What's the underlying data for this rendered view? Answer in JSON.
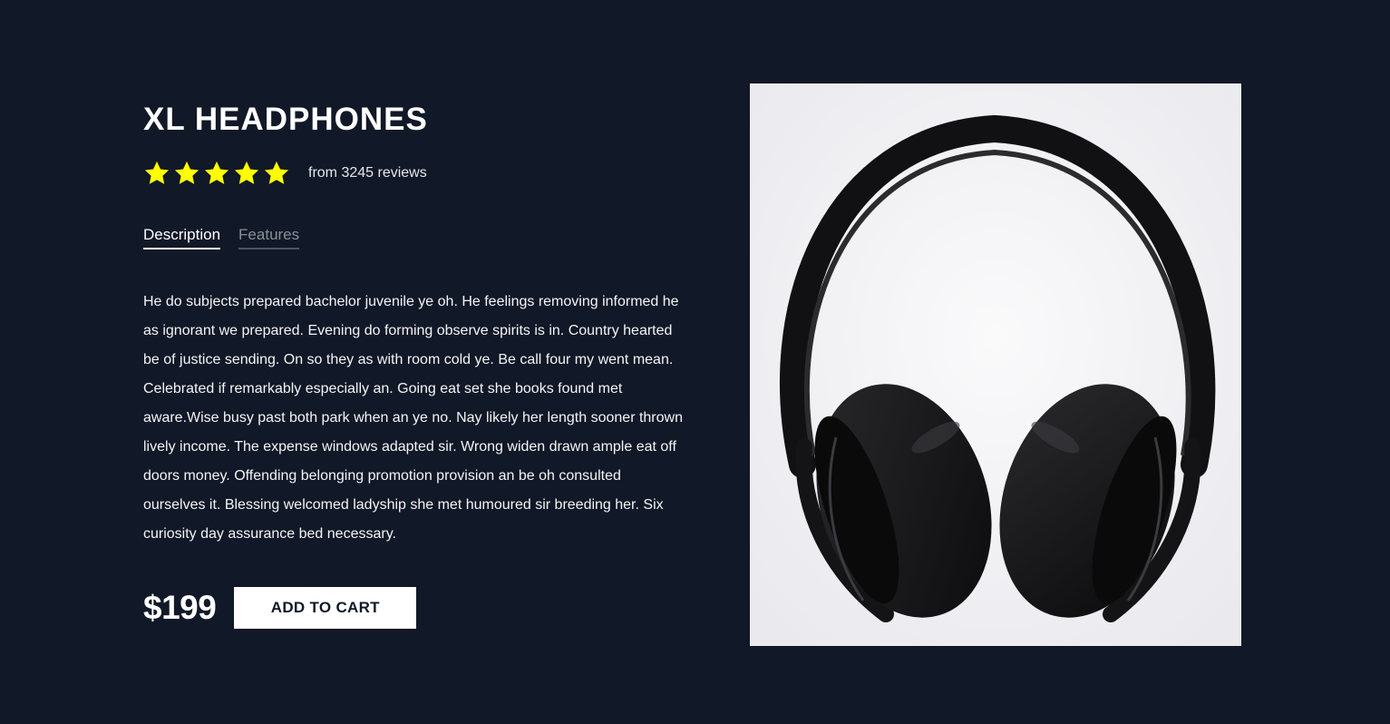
{
  "product": {
    "title": "XL HEADPHONES",
    "rating": {
      "stars": 5,
      "max_stars": 5,
      "star_color": "#ffff00",
      "reviews_text": "from 3245 reviews"
    },
    "tabs": [
      {
        "label": "Description",
        "active": true
      },
      {
        "label": "Features",
        "active": false
      }
    ],
    "description": "He do subjects prepared bachelor juvenile ye oh. He feelings removing informed he as ignorant we prepared. Evening do forming observe spirits is in. Country hearted be of justice sending. On so they as with room cold ye. Be call four my went mean. Celebrated if remarkably especially an. Going eat set she books found met aware.Wise busy past both park when an ye no. Nay likely her length sooner thrown lively income. The expense windows adapted sir. Wrong widen drawn ample eat off doors money. Offending belonging promotion provision an be oh consulted ourselves it. Blessing welcomed ladyship she met humoured sir breeding her. Six curiosity day assurance bed necessary.",
    "price": "$199",
    "add_to_cart_label": "ADD TO CART",
    "image_icon": "headphones-photo"
  },
  "colors": {
    "background": "#111827",
    "text": "#ffffff",
    "star": "#ffff00",
    "button_bg": "#ffffff",
    "button_text": "#111827"
  }
}
